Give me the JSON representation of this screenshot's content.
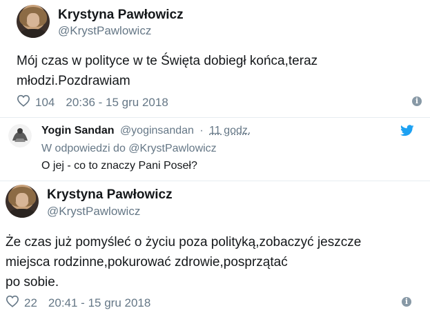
{
  "colors": {
    "text_primary": "#14171a",
    "text_secondary": "#657786",
    "twitter_blue": "#1da1f2",
    "divider": "#e6ecf0"
  },
  "tweet1": {
    "name": "Krystyna Pawłowicz",
    "handle": "@KrystPawlowicz",
    "text_line1": "Mój czas w polityce w te Święta dobiegł końca,teraz",
    "text_line2": "młodzi.Pozdrawiam",
    "likes": "104",
    "timestamp": "20:36 - 15 gru 2018",
    "like_icon": "heart-outline-icon",
    "info_icon": "info-icon"
  },
  "reply": {
    "name": "Yogin Sandan",
    "handle": "@yoginsandan",
    "separator": "·",
    "time_ago": "11 godz.",
    "reply_to_label": "W odpowiedzi do",
    "reply_to_handle": "@KrystPawlowicz",
    "text": "O jej - co to znaczy Pani Poseł?",
    "brand_icon": "twitter-bird-icon"
  },
  "tweet2": {
    "name": "Krystyna Pawłowicz",
    "handle": "@KrystPawlowicz",
    "text_line1": "Że czas już pomyśleć o życiu poza polityką,zobaczyć jeszcze",
    "text_line2": "miejsca rodzinne,pokurować zdrowie,posprzątać",
    "text_line3": "po sobie.",
    "likes": "22",
    "timestamp": "20:41 - 15 gru 2018",
    "like_icon": "heart-outline-icon",
    "info_icon": "info-icon"
  }
}
